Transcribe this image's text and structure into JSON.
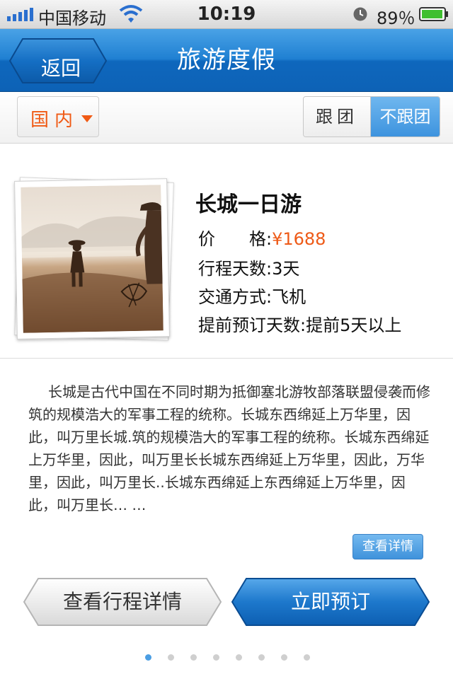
{
  "status_bar": {
    "carrier": "中国移动",
    "time": "10:19",
    "battery": "89％"
  },
  "nav": {
    "back_label": "返回",
    "title": "旅游度假"
  },
  "filter": {
    "region": "国内",
    "segments": [
      "跟团",
      "不跟团"
    ],
    "selected_segment": "不跟团"
  },
  "product": {
    "title": "长城一日游",
    "price_label": "价　　格:",
    "price_value": "¥1688",
    "days_label": "行程天数:",
    "days_value": "3天",
    "transport_label": "交通方式:",
    "transport_value": "飞机",
    "advance_label": "提前预订天数:",
    "advance_value": "提前5天以上",
    "description": "长城是古代中国在不同时期为抵御塞北游牧部落联盟侵袭而修筑的规模浩大的军事工程的统称。长城东西绵延上万华里，因此，叫万里长城.筑的规模浩大的军事工程的统称。长城东西绵延上万华里，因此，叫万里长长城东西绵延上万华里，因此，万华里，因此，叫万里长..长城东西绵延上东西绵延上万华里，因此，叫万里长… …"
  },
  "buttons": {
    "view_details": "查看详情",
    "view_itinerary": "查看行程详情",
    "book_now": "立即预订"
  },
  "pagination": {
    "total": 8,
    "active": 1
  },
  "colors": {
    "accent_blue": "#1f80d2",
    "price_orange": "#ee5a17"
  }
}
